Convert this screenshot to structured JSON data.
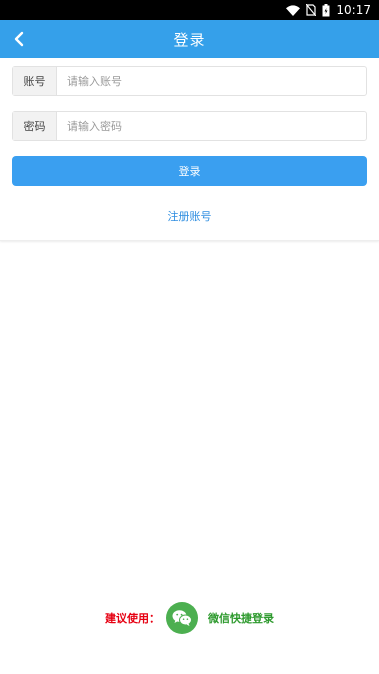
{
  "status_bar": {
    "time": "10:17",
    "icons": [
      "wifi-icon",
      "no-sim-icon",
      "battery-icon"
    ]
  },
  "header": {
    "title": "登录",
    "back_icon": "chevron-left-icon",
    "color": "#35a0ea"
  },
  "form": {
    "account_label": "账号",
    "account_placeholder": "请输入账号",
    "account_value": "",
    "password_label": "密码",
    "password_placeholder": "请输入密码",
    "password_value": "",
    "login_label": "登录",
    "register_label": "注册账号",
    "button_color": "#3a9ff0"
  },
  "footer": {
    "suggest_text": "建议使用：",
    "wechat_icon": "wechat-icon",
    "wechat_label": "微信快捷登录",
    "suggest_color": "#e60012",
    "wechat_color": "#4caf50"
  }
}
